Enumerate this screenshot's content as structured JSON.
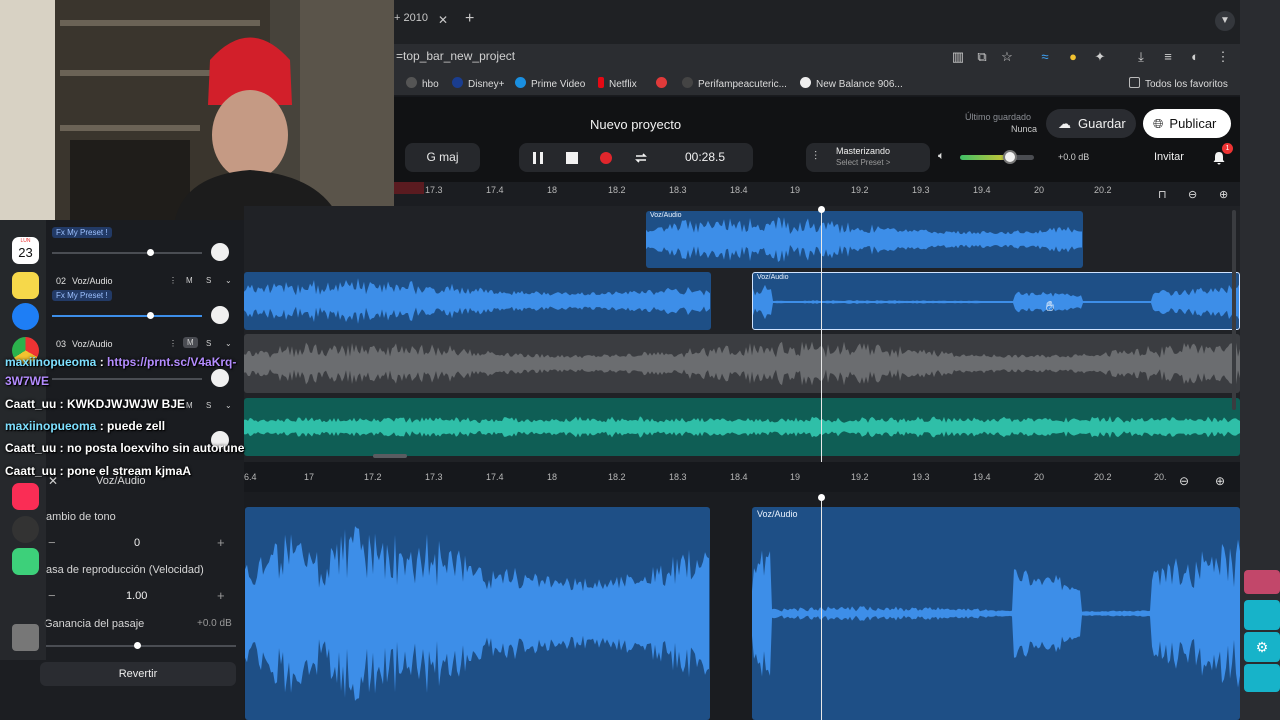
{
  "browser": {
    "tab_peek": "+ 2010",
    "url": "=top_bar_new_project",
    "bookmarks": [
      "hbo",
      "Disney+",
      "Prime Video",
      "Netflix",
      "Perifampeacuteric...",
      "New Balance 906..."
    ],
    "all_bookmarks": "Todos los favoritos"
  },
  "header": {
    "project_title": "Nuevo proyecto",
    "last_saved_label": "Último guardado",
    "last_saved_value": "Nunca",
    "save_label": "Guardar",
    "publish_label": "Publicar",
    "key": "G maj",
    "time": "00:28.5",
    "mastering_title": "Masterizando",
    "mastering_preset": "Select Preset >",
    "volume_db": "+0.0 dB",
    "volume_level": 0.7,
    "invite_label": "Invitar",
    "notification_count": "1"
  },
  "ruler_top": [
    "17.3",
    "17.4",
    "18",
    "18.2",
    "18.3",
    "18.4",
    "19",
    "19.2",
    "19.3",
    "19.4",
    "20",
    "20.2"
  ],
  "ruler_bottom": [
    "6.4",
    "17",
    "17.2",
    "17.3",
    "17.4",
    "18",
    "18.2",
    "18.3",
    "18.4",
    "19",
    "19.2",
    "19.3",
    "19.4",
    "20",
    "20.2",
    "20."
  ],
  "tracks": [
    {
      "number": "",
      "name": "",
      "preset": "Fx My Preset !"
    },
    {
      "number": "02",
      "name": "Voz/Audio",
      "preset": "Fx My Preset !",
      "mute": "M",
      "solo": "S"
    },
    {
      "number": "03",
      "name": "Voz/Audio",
      "preset": "Fx My Preset !",
      "mute": "M",
      "solo": "S"
    },
    {
      "number": "",
      "name": "",
      "preset": "",
      "mute": "M",
      "solo": "S"
    }
  ],
  "clip_label": "Voz/Audio",
  "editor": {
    "clip_name": "Voz/Audio",
    "pitch_label": "ambio de tono",
    "pitch_value": "0",
    "rate_label": "asa de reproducción (Velocidad)",
    "rate_value": "1.00",
    "gain_label": "Ganancia del pasaje",
    "gain_value": "+0.0 dB",
    "revert_label": "Revertir"
  },
  "dock": {
    "calendar_day": "23",
    "calendar_month": "LUN"
  },
  "chat": [
    {
      "user": "maxiinopueoma",
      "msg": "https://prnt.sc/V4aKrq-",
      "extra": "3W7WE",
      "link": true
    },
    {
      "user": "Caatt_uu",
      "msg": "KWKDJWJWJW BJE"
    },
    {
      "user": "maxiinopueoma",
      "msg": "puede zell"
    },
    {
      "user": "Caatt_uu",
      "msg": "no posta loexviho sin autorune"
    },
    {
      "user": "Caatt_uu",
      "msg": "pone el stream kjmaA"
    }
  ],
  "colors": {
    "clip_blue": "#3d8ee8",
    "clip_dark": "#1e4f86",
    "clip_gray": "#6b6d70",
    "clip_teal": "#2fbfa8",
    "accent_red": "#e0262c"
  }
}
